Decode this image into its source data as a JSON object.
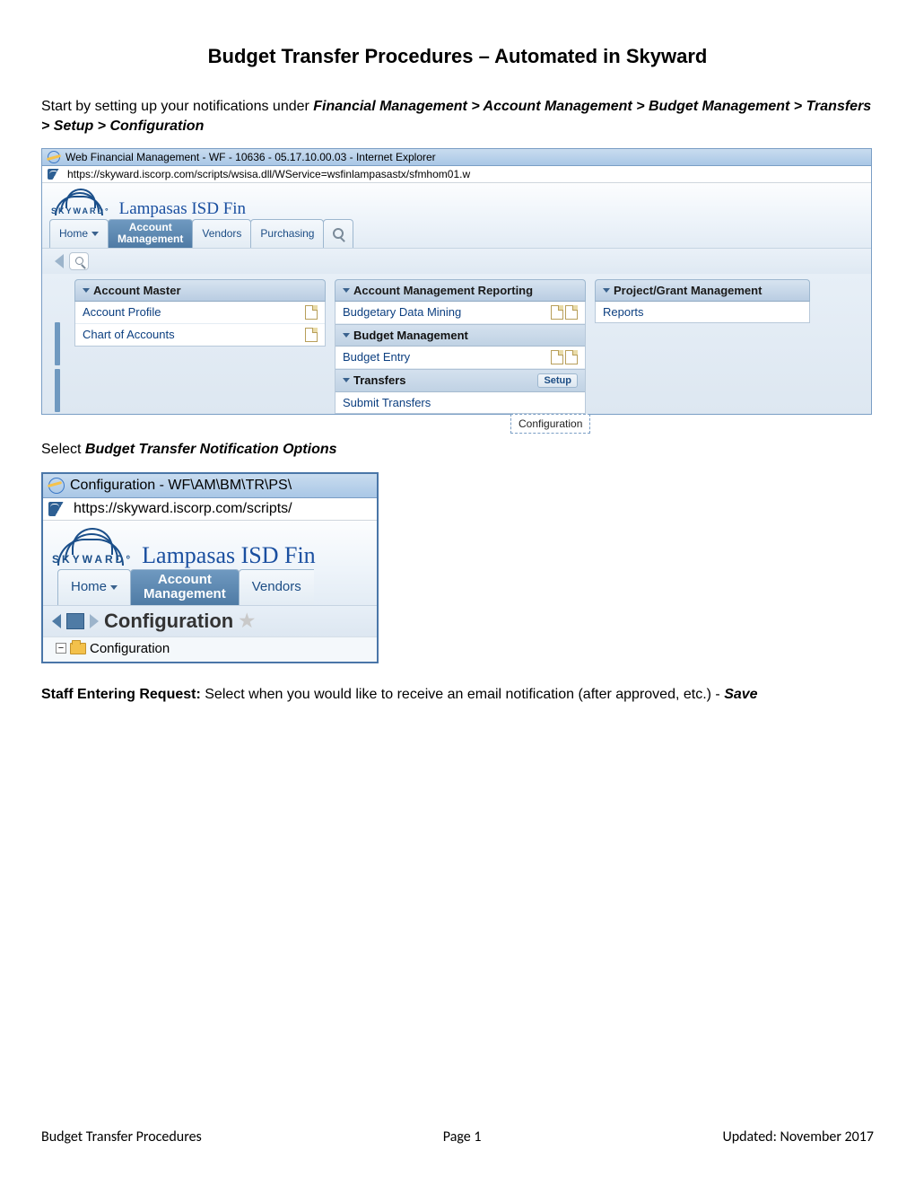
{
  "doc": {
    "title": "Budget Transfer Procedures – Automated in Skyward",
    "intro_a": "Start by setting up your notifications under ",
    "intro_b": "Financial Management > Account Management > Budget Management > Transfers > Setup > Configuration",
    "select_a": "Select ",
    "select_b": "Budget Transfer Notification Options",
    "staff_a": "Staff Entering Request:",
    "staff_b": " Select when you would like to receive an email notification (after approved, etc.) - ",
    "staff_c": "Save",
    "footer_left": "Budget Transfer Procedures",
    "footer_mid": "Page 1",
    "footer_right": "Updated: November 2017"
  },
  "s1": {
    "title": "Web Financial Management - WF - 10636 - 05.17.10.00.03 - Internet Explorer",
    "url": "https://skyward.iscorp.com/scripts/wsisa.dll/WService=wsfinlampasastx/sfmhom01.w",
    "org": "Lampasas ISD Fin",
    "tabs": {
      "home": "Home",
      "acct": "Account\nManagement",
      "vendors": "Vendors",
      "purchasing": "Purchasing"
    },
    "col1": {
      "head": "Account Master",
      "items": [
        "Account Profile",
        "Chart of Accounts"
      ]
    },
    "col2": {
      "head": "Account Management Reporting",
      "items": [
        "Budgetary Data Mining"
      ],
      "sub1": "Budget Management",
      "sub1_items": [
        "Budget Entry"
      ],
      "sub2": "Transfers",
      "setup": "Setup",
      "sub2_items": [
        "Submit Transfers"
      ],
      "flyout": "Configuration"
    },
    "col3": {
      "head": "Project/Grant Management",
      "items": [
        "Reports"
      ]
    }
  },
  "s2": {
    "title": "Configuration - WF\\AM\\BM\\TR\\PS\\",
    "url": "https://skyward.iscorp.com/scripts/",
    "org": "Lampasas ISD Fin",
    "tabs": {
      "home": "Home",
      "acct": "Account\nManagement",
      "vendors": "Vendors"
    },
    "crumb": "Configuration",
    "tree": "Configuration"
  }
}
